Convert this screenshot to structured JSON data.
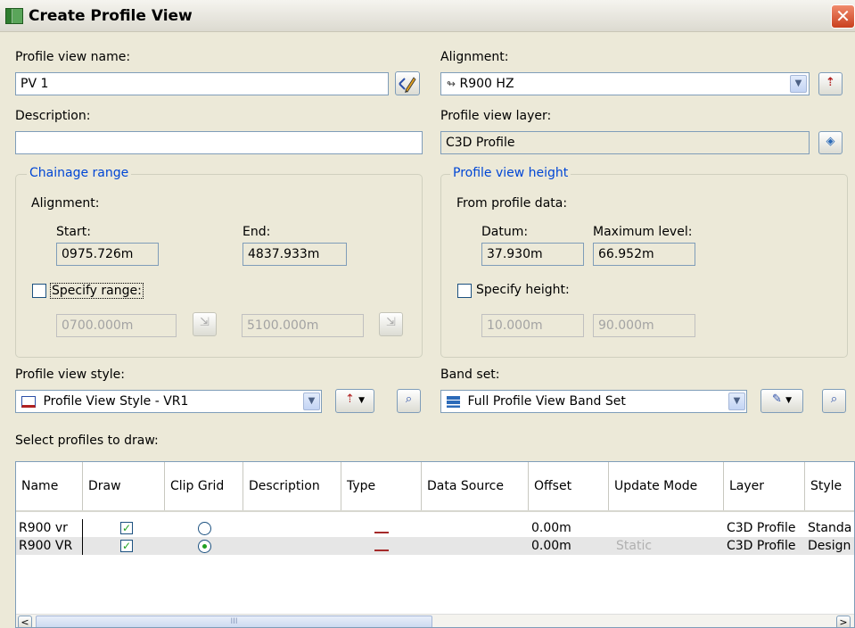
{
  "window": {
    "title": "Create Profile View",
    "close_glyph": "✕"
  },
  "profile_view_name": {
    "label": "Profile view name:",
    "value": "PV 1"
  },
  "description": {
    "label": "Description:",
    "value": ""
  },
  "alignment": {
    "label": "Alignment:",
    "value": "R900 HZ"
  },
  "profile_view_layer": {
    "label": "Profile view layer:",
    "value": "C3D Profile"
  },
  "chainage_range": {
    "legend": "Chainage range",
    "alignment_label": "Alignment:",
    "start_label": "Start:",
    "start_value": "0975.726m",
    "end_label": "End:",
    "end_value": "4837.933m",
    "specify_label": "Specify range:",
    "specify_checked": false,
    "range_start": "0700.000m",
    "range_end": "5100.000m"
  },
  "profile_view_height": {
    "legend": "Profile view height",
    "from_label": "From profile data:",
    "datum_label": "Datum:",
    "datum_value": "37.930m",
    "max_label": "Maximum level:",
    "max_value": "66.952m",
    "specify_label": "Specify height:",
    "specify_checked": false,
    "height_min": "10.000m",
    "height_max": "90.000m"
  },
  "profile_view_style": {
    "label": "Profile view style:",
    "value": "Profile View Style - VR1"
  },
  "band_set": {
    "label": "Band set:",
    "value": "Full Profile View Band Set"
  },
  "select_profiles_label": "Select profiles to draw:",
  "table": {
    "columns": [
      "Name",
      "Draw",
      "Clip Grid",
      "Description",
      "Type",
      "Data Source",
      "Offset",
      "Update Mode",
      "Layer",
      "Style"
    ],
    "rows": [
      {
        "name": "R900 vr",
        "draw": true,
        "clip_grid": false,
        "description": "",
        "data_source": "",
        "offset": "0.00m",
        "update_mode": "",
        "layer": "C3D Profile",
        "style": "Standa"
      },
      {
        "name": "R900 VR",
        "draw": true,
        "clip_grid": true,
        "description": "",
        "data_source": "",
        "offset": "0.00m",
        "update_mode": "Static",
        "layer": "C3D Profile",
        "style": "Design"
      }
    ]
  },
  "scroll": {
    "left_glyph": "<",
    "right_glyph": ">",
    "thumb_glyph": "III"
  },
  "colors": {
    "legend": "#0046d5",
    "checkmark": "#21a121",
    "window_bg": "#ece9d8",
    "input_border": "#7f9db9"
  },
  "icons": [
    "app-icon",
    "pencil-icon",
    "pick-alignment-icon",
    "layer-icon",
    "pick-station-icon",
    "profile-style-icon",
    "band-set-icon",
    "zoom-icon",
    "close-icon"
  ]
}
